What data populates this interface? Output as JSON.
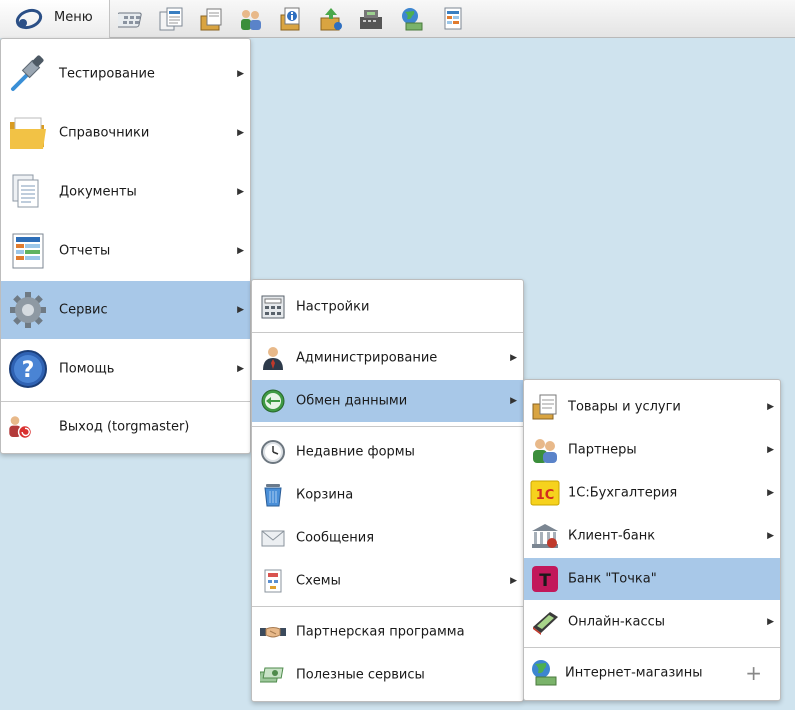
{
  "toolbar": {
    "menu_label": "Меню",
    "quick_icons": [
      "calculator-icon",
      "invoice-icon",
      "box-document-icon",
      "partners-icon",
      "document-info-icon",
      "box-upload-icon",
      "cash-register-icon",
      "globe-money-icon",
      "spreadsheet-icon"
    ]
  },
  "main_menu": {
    "items": [
      {
        "label": "Тестирование",
        "icon": "dropper-icon",
        "has_submenu": true
      },
      {
        "label": "Справочники",
        "icon": "folder-icon",
        "has_submenu": true
      },
      {
        "label": "Документы",
        "icon": "documents-icon",
        "has_submenu": true
      },
      {
        "label": "Отчеты",
        "icon": "report-icon",
        "has_submenu": true
      },
      {
        "label": "Сервис",
        "icon": "gear-icon",
        "has_submenu": true,
        "selected": true
      },
      {
        "label": "Помощь",
        "icon": "help-icon",
        "has_submenu": true
      },
      {
        "label": "Выход (torgmaster)",
        "icon": "logout-user-icon",
        "has_submenu": false
      }
    ]
  },
  "service_menu": {
    "items": [
      {
        "label": "Настройки",
        "icon": "settings-panel-icon"
      },
      {
        "label": "Администрирование",
        "icon": "admin-user-icon",
        "has_submenu": true
      },
      {
        "label": "Обмен данными",
        "icon": "exchange-icon",
        "has_submenu": true,
        "selected": true
      },
      {
        "label": "Недавние формы",
        "icon": "clock-icon"
      },
      {
        "label": "Корзина",
        "icon": "trash-icon"
      },
      {
        "label": "Сообщения",
        "icon": "envelope-icon"
      },
      {
        "label": "Схемы",
        "icon": "schema-icon",
        "has_submenu": true
      },
      {
        "label": "Партнерская программа",
        "icon": "handshake-icon"
      },
      {
        "label": "Полезные сервисы",
        "icon": "money-tools-icon"
      }
    ]
  },
  "exchange_menu": {
    "items": [
      {
        "label": "Товары и услуги",
        "icon": "goods-icon",
        "has_submenu": true
      },
      {
        "label": "Партнеры",
        "icon": "partners-icon",
        "has_submenu": true
      },
      {
        "label": "1С:Бухгалтерия",
        "icon": "one-c-icon",
        "has_submenu": true,
        "icon_text": "1С"
      },
      {
        "label": "Клиент-банк",
        "icon": "bank-icon",
        "has_submenu": true
      },
      {
        "label": "Банк \"Точка\"",
        "icon": "tochka-bank-icon",
        "selected": true,
        "icon_text": "T"
      },
      {
        "label": "Онлайн-кассы",
        "icon": "pos-terminal-icon",
        "has_submenu": true
      },
      {
        "label": "Интернет-магазины",
        "icon": "globe-money-icon",
        "plus": "+"
      }
    ]
  },
  "colors": {
    "selection": "#a8c8e8",
    "desktop": "#cfe3ee",
    "tochka": "#c2185b"
  }
}
